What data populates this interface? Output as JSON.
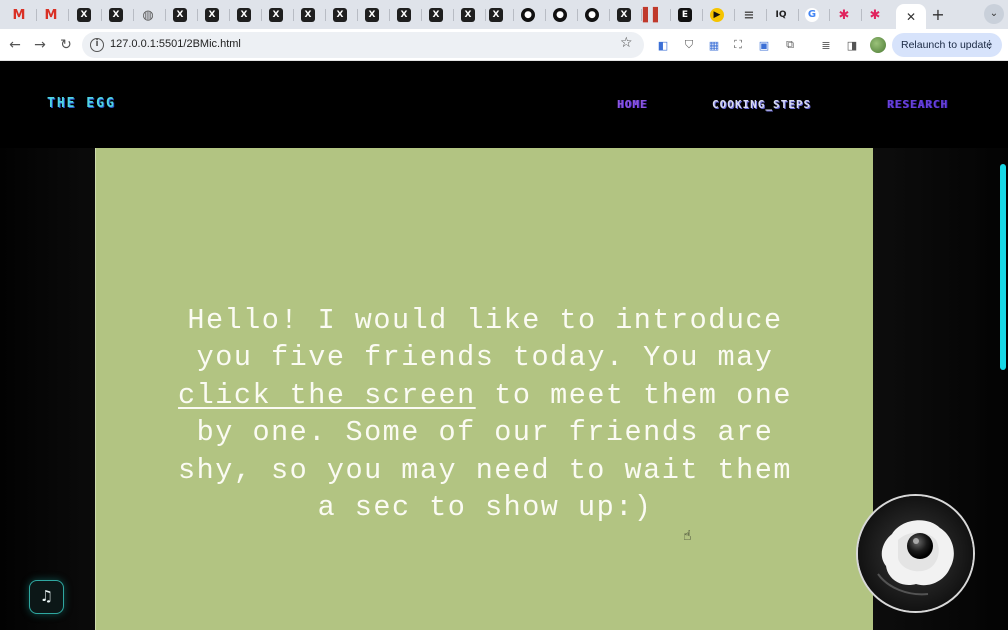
{
  "browser": {
    "url": "127.0.0.1:5501/2BMic.html",
    "relaunch_label": "Relaunch to update",
    "tabs": [
      {
        "icon": "gmail-icon",
        "glyph": "M"
      },
      {
        "icon": "gmail-icon",
        "glyph": "M"
      },
      {
        "icon": "x-icon",
        "glyph": "X"
      },
      {
        "icon": "x-icon",
        "glyph": "X"
      },
      {
        "icon": "globe-icon",
        "glyph": "◍"
      },
      {
        "icon": "x-icon",
        "glyph": "X"
      },
      {
        "icon": "x-icon",
        "glyph": "X"
      },
      {
        "icon": "x-icon",
        "glyph": "X"
      },
      {
        "icon": "x-icon",
        "glyph": "X"
      },
      {
        "icon": "x-icon",
        "glyph": "X"
      },
      {
        "icon": "x-icon",
        "glyph": "X"
      },
      {
        "icon": "x-icon",
        "glyph": "X"
      },
      {
        "icon": "x-icon",
        "glyph": "X"
      },
      {
        "icon": "x-icon",
        "glyph": "X"
      },
      {
        "icon": "x-icon",
        "glyph": "X"
      },
      {
        "icon": "x-icon",
        "glyph": "X"
      },
      {
        "icon": "github-icon",
        "glyph": "●"
      },
      {
        "icon": "github-icon",
        "glyph": "●"
      },
      {
        "icon": "github-icon",
        "glyph": "●"
      },
      {
        "icon": "x-icon",
        "glyph": "X"
      },
      {
        "icon": "bars-icon",
        "glyph": "▌▌"
      },
      {
        "icon": "e-icon",
        "glyph": "E"
      },
      {
        "icon": "yellow-icon",
        "glyph": "▶"
      },
      {
        "icon": "lines-icon",
        "glyph": "≡"
      },
      {
        "icon": "iq-icon",
        "glyph": "IQ"
      },
      {
        "icon": "google-icon",
        "glyph": "G"
      },
      {
        "icon": "star-icon",
        "glyph": "✱"
      },
      {
        "icon": "star-icon",
        "glyph": "✱"
      }
    ],
    "active_tab_close": "✕",
    "new_tab": "+",
    "tab_menu": "⌄"
  },
  "site": {
    "brand": "THE EGG",
    "nav": {
      "home": "HOME",
      "cooking_steps": "COOKING_STEPS",
      "research": "RESEARCH"
    }
  },
  "intro": {
    "before_link": "Hello! I would like to introduce you five friends today. You may ",
    "link_text": "click the screen",
    "after_link": " to meet them one by one. Some of our friends are shy, so you may need to wait them a sec to show up:)"
  },
  "colors": {
    "panel": "#b2c482",
    "brand_cyan": "#4fd4e3",
    "scrollbar": "#17d8e6"
  }
}
